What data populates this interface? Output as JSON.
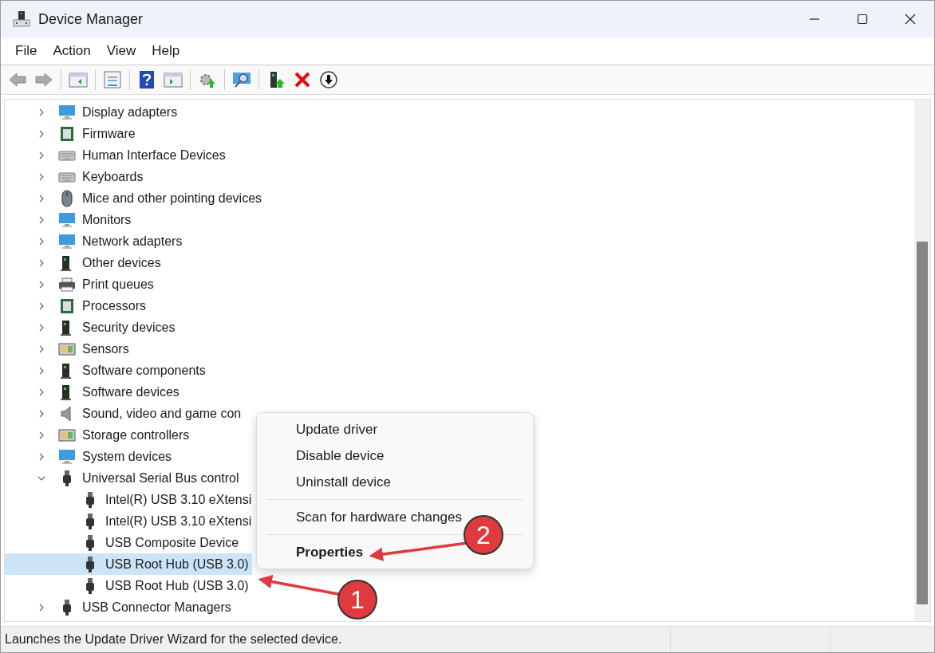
{
  "window": {
    "title": "Device Manager"
  },
  "menu": [
    "File",
    "Action",
    "View",
    "Help"
  ],
  "tree": [
    {
      "label": "Display adapters",
      "expanded": false,
      "selected": false
    },
    {
      "label": "Firmware",
      "expanded": false,
      "selected": false
    },
    {
      "label": "Human Interface Devices",
      "expanded": false,
      "selected": false
    },
    {
      "label": "Keyboards",
      "expanded": false,
      "selected": false
    },
    {
      "label": "Mice and other pointing devices",
      "expanded": false,
      "selected": false
    },
    {
      "label": "Monitors",
      "expanded": false,
      "selected": false
    },
    {
      "label": "Network adapters",
      "expanded": false,
      "selected": false
    },
    {
      "label": "Other devices",
      "expanded": false,
      "selected": false
    },
    {
      "label": "Print queues",
      "expanded": false,
      "selected": false
    },
    {
      "label": "Processors",
      "expanded": false,
      "selected": false
    },
    {
      "label": "Security devices",
      "expanded": false,
      "selected": false
    },
    {
      "label": "Sensors",
      "expanded": false,
      "selected": false
    },
    {
      "label": "Software components",
      "expanded": false,
      "selected": false
    },
    {
      "label": "Software devices",
      "expanded": false,
      "selected": false
    },
    {
      "label": "Sound, video and game con",
      "expanded": false,
      "selected": false
    },
    {
      "label": "Storage controllers",
      "expanded": false,
      "selected": false
    },
    {
      "label": "System devices",
      "expanded": false,
      "selected": false
    },
    {
      "label": "Universal Serial Bus control",
      "expanded": true,
      "selected": false,
      "children": [
        {
          "label": "Intel(R) USB 3.10 eXtensi",
          "selected": false
        },
        {
          "label": "Intel(R) USB 3.10 eXtensi",
          "selected": false
        },
        {
          "label": "USB Composite Device",
          "selected": false
        },
        {
          "label": "USB Root Hub (USB 3.0)",
          "selected": true
        },
        {
          "label": "USB Root Hub (USB 3.0)",
          "selected": false
        }
      ]
    },
    {
      "label": "USB Connector Managers",
      "expanded": false,
      "selected": false
    }
  ],
  "context_menu": {
    "groups": [
      [
        {
          "label": "Update driver",
          "default": false
        },
        {
          "label": "Disable device",
          "default": false
        },
        {
          "label": "Uninstall device",
          "default": false
        }
      ],
      [
        {
          "label": "Scan for hardware changes",
          "default": false
        }
      ],
      [
        {
          "label": "Properties",
          "default": true
        }
      ]
    ]
  },
  "status_bar": {
    "text": "Launches the Update Driver Wizard for the selected device."
  },
  "annotations": [
    {
      "label": "1"
    },
    {
      "label": "2"
    }
  ]
}
